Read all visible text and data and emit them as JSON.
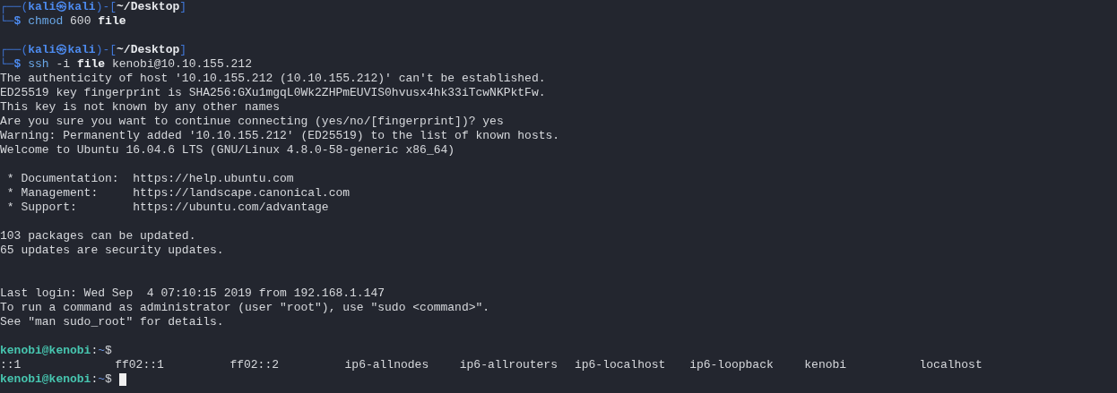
{
  "lines": [
    {
      "kind": "kali_prompt",
      "open": "┌──(",
      "user_host": "kali㉿kali",
      "middle": ")-[",
      "path": "~/Desktop",
      "close": "]"
    },
    {
      "kind": "kali_command",
      "corner": "└─",
      "symbol": "$",
      "tokens": [
        {
          "text": "chmod",
          "kind": "command"
        },
        {
          "text": "600",
          "kind": "arg"
        },
        {
          "text": "file",
          "kind": "file"
        }
      ]
    },
    {
      "kind": "blank"
    },
    {
      "kind": "kali_prompt",
      "open": "┌──(",
      "user_host": "kali㉿kali",
      "middle": ")-[",
      "path": "~/Desktop",
      "close": "]"
    },
    {
      "kind": "kali_command",
      "corner": "└─",
      "symbol": "$",
      "tokens": [
        {
          "text": "ssh",
          "kind": "command"
        },
        {
          "text": "-i",
          "kind": "arg"
        },
        {
          "text": "file",
          "kind": "file"
        },
        {
          "text": "kenobi@10.10.155.212",
          "kind": "arg"
        }
      ]
    },
    {
      "kind": "text",
      "text": "The authenticity of host '10.10.155.212 (10.10.155.212)' can't be established."
    },
    {
      "kind": "text",
      "text": "ED25519 key fingerprint is SHA256:GXu1mgqL0Wk2ZHPmEUVIS0hvusx4hk33iTcwNKPktFw."
    },
    {
      "kind": "text",
      "text": "This key is not known by any other names"
    },
    {
      "kind": "text",
      "text": "Are you sure you want to continue connecting (yes/no/[fingerprint])? yes"
    },
    {
      "kind": "text",
      "text": "Warning: Permanently added '10.10.155.212' (ED25519) to the list of known hosts."
    },
    {
      "kind": "text",
      "text": "Welcome to Ubuntu 16.04.6 LTS (GNU/Linux 4.8.0-58-generic x86_64)"
    },
    {
      "kind": "blank"
    },
    {
      "kind": "text",
      "text": " * Documentation:  https://help.ubuntu.com"
    },
    {
      "kind": "text",
      "text": " * Management:     https://landscape.canonical.com"
    },
    {
      "kind": "text",
      "text": " * Support:        https://ubuntu.com/advantage"
    },
    {
      "kind": "blank"
    },
    {
      "kind": "text",
      "text": "103 packages can be updated."
    },
    {
      "kind": "text",
      "text": "65 updates are security updates."
    },
    {
      "kind": "blank"
    },
    {
      "kind": "blank"
    },
    {
      "kind": "text",
      "text": "Last login: Wed Sep  4 07:10:15 2019 from 192.168.1.147"
    },
    {
      "kind": "text",
      "text": "To run a command as administrator (user \"root\"), use \"sudo <command>\"."
    },
    {
      "kind": "text",
      "text": "See \"man sudo_root\" for details."
    },
    {
      "kind": "blank"
    },
    {
      "kind": "prompt",
      "user_host": "kenobi@kenobi",
      "sep": ":",
      "path": "~",
      "symbol": "$",
      "cursor": false
    },
    {
      "kind": "columns",
      "items": [
        "::1",
        "ff02::1",
        "ff02::2",
        "ip6-allnodes",
        "ip6-allrouters",
        "ip6-localhost",
        "ip6-loopback",
        "kenobi",
        "localhost"
      ]
    },
    {
      "kind": "prompt",
      "user_host": "kenobi@kenobi",
      "sep": ":",
      "path": "~",
      "symbol": "$",
      "cursor": true
    }
  ]
}
